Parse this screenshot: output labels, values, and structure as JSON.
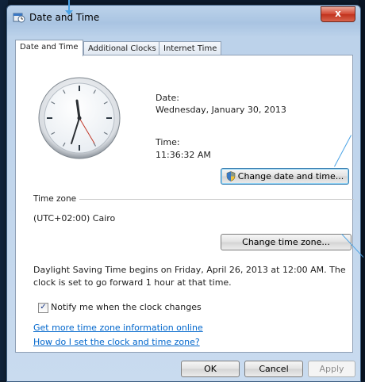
{
  "window": {
    "title": "Date and Time",
    "close_label": "x"
  },
  "tabs": [
    {
      "label": "Date and Time"
    },
    {
      "label": "Additional Clocks"
    },
    {
      "label": "Internet Time"
    }
  ],
  "datetime": {
    "date_label": "Date:",
    "date_value": "Wednesday, January 30, 2013",
    "time_label": "Time:",
    "time_value": "11:36:32 AM",
    "change_button": "Change date and time..."
  },
  "timezone": {
    "group_label": "Time zone",
    "value": "(UTC+02:00) Cairo",
    "change_button": "Change time zone...",
    "dst_line1": "Daylight Saving Time begins on Friday, April 26, 2013 at 12:00 AM. The",
    "dst_line2": "clock is set to go forward 1 hour at that time."
  },
  "notify": {
    "label": "Notify me when the clock changes",
    "checked": true
  },
  "links": {
    "more_info": "Get more time zone information online",
    "how_to": "How do I set the clock and time zone?"
  },
  "buttons": {
    "ok": "OK",
    "cancel": "Cancel",
    "apply": "Apply"
  },
  "colors": {
    "link": "#0066cc",
    "annotation": "#4aa3e6"
  }
}
